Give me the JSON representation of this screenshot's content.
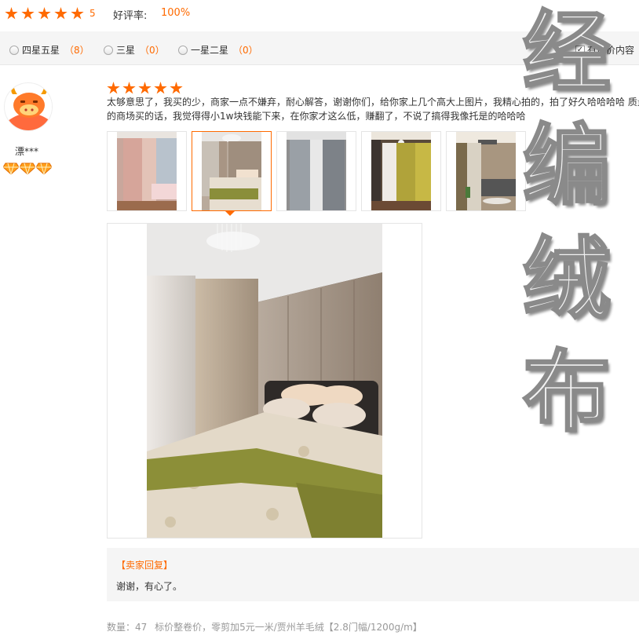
{
  "summary": {
    "stars": 5,
    "score": "5",
    "rate_label": "好评率:",
    "rate_value": "100%"
  },
  "filters": [
    {
      "label": "四星五星",
      "count": "（8）"
    },
    {
      "label": "三星",
      "count": "（0）"
    },
    {
      "label": "一星二星",
      "count": "（0）"
    }
  ],
  "filter_check": {
    "label": "有评价内容",
    "checked": true
  },
  "review": {
    "username": "漂***",
    "stars": 5,
    "text_line1": "太够意思了，我买的少，商家一点不嫌弃，耐心解答，谢谢你们，给你家上几个高大上图片，我精心拍的，拍了好久哈哈哈哈 质量",
    "text_line2": "的商场买的话，我觉得得小1w块钱能下来，在你家才这么低，赚翻了，不说了搞得我像托是的哈哈哈",
    "photos": [
      "photo-1",
      "photo-2",
      "photo-3",
      "photo-4",
      "photo-5"
    ],
    "active_photo": 2
  },
  "reply": {
    "title": "【卖家回复】",
    "text": "谢谢，有心了。"
  },
  "meta": {
    "quantity": "数量：47",
    "variant": "标价整卷价，零剪加5元一米/贾州羊毛绒【2.8门幅/1200g/m】"
  },
  "watermark": {
    "chars": [
      "经",
      "编",
      "绒",
      "布"
    ]
  },
  "colors": {
    "accent": "#ff6a00",
    "panel": "#f5f5f5"
  },
  "icons": {
    "avatar": "cartoon-cow-avatar-icon",
    "badge": "diamond-icon",
    "star": "star-icon"
  }
}
